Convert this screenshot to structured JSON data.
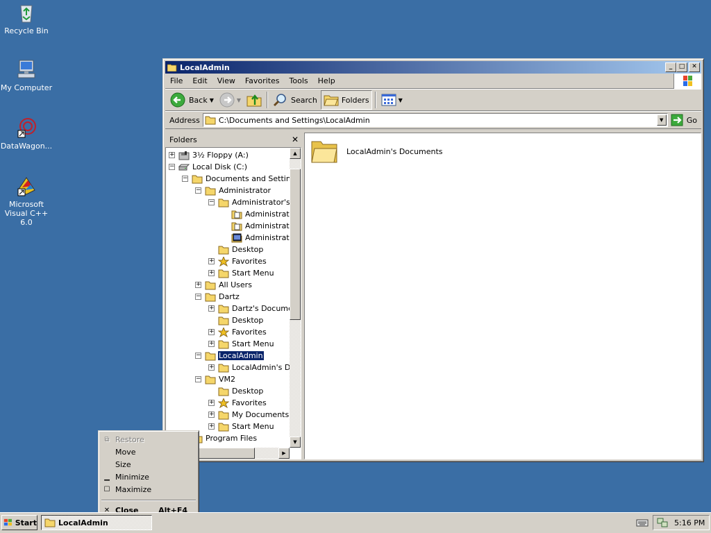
{
  "desktop": {
    "icons": [
      {
        "label": "Recycle Bin"
      },
      {
        "label": "My Computer"
      },
      {
        "label": "DataWagon..."
      },
      {
        "label": "Microsoft Visual C++ 6.0"
      }
    ]
  },
  "window": {
    "title": "LocalAdmin",
    "menu": [
      "File",
      "Edit",
      "View",
      "Favorites",
      "Tools",
      "Help"
    ],
    "toolbar": {
      "back_label": "Back",
      "search_label": "Search",
      "folders_label": "Folders"
    },
    "address": {
      "label": "Address",
      "value": "C:\\Documents and Settings\\LocalAdmin",
      "go_label": "Go"
    },
    "folders_pane": {
      "title": "Folders",
      "tree": [
        {
          "label": "3½ Floppy (A:)",
          "expander": "+",
          "icon": "floppy-drive-icon"
        },
        {
          "label": "Local Disk (C:)",
          "expander": "−",
          "icon": "hard-disk-icon"
        },
        {
          "label": "Documents and Settings",
          "expander": "−",
          "icon": "folder-icon"
        },
        {
          "label": "Administrator",
          "expander": "−",
          "icon": "folder-icon"
        },
        {
          "label": "Administrator's Documents",
          "expander": "−",
          "icon": "folder-icon"
        },
        {
          "label": "Administrator",
          "expander": "",
          "icon": "document-folder-icon"
        },
        {
          "label": "Administrator",
          "expander": "",
          "icon": "document-folder-icon"
        },
        {
          "label": "Administrator",
          "expander": "",
          "icon": "video-folder-icon"
        },
        {
          "label": "Desktop",
          "expander": "",
          "icon": "folder-icon"
        },
        {
          "label": "Favorites",
          "expander": "+",
          "icon": "favorites-star-icon"
        },
        {
          "label": "Start Menu",
          "expander": "+",
          "icon": "folder-icon"
        },
        {
          "label": "All Users",
          "expander": "+",
          "icon": "folder-icon"
        },
        {
          "label": "Dartz",
          "expander": "−",
          "icon": "folder-icon"
        },
        {
          "label": "Dartz's Documents",
          "expander": "+",
          "icon": "folder-icon"
        },
        {
          "label": "Desktop",
          "expander": "",
          "icon": "folder-icon"
        },
        {
          "label": "Favorites",
          "expander": "+",
          "icon": "favorites-star-icon"
        },
        {
          "label": "Start Menu",
          "expander": "+",
          "icon": "folder-icon"
        },
        {
          "label": "LocalAdmin",
          "expander": "−",
          "icon": "folder-icon",
          "selected": true
        },
        {
          "label": "LocalAdmin's Documents",
          "expander": "+",
          "icon": "folder-icon"
        },
        {
          "label": "VM2",
          "expander": "−",
          "icon": "folder-icon"
        },
        {
          "label": "Desktop",
          "expander": "",
          "icon": "folder-icon"
        },
        {
          "label": "Favorites",
          "expander": "+",
          "icon": "favorites-star-icon"
        },
        {
          "label": "My Documents",
          "expander": "+",
          "icon": "folder-icon"
        },
        {
          "label": "Start Menu",
          "expander": "+",
          "icon": "folder-icon"
        },
        {
          "label": "Program Files",
          "expander": "+",
          "icon": "folder-icon"
        }
      ]
    },
    "files": [
      {
        "label": "LocalAdmin's Documents"
      }
    ]
  },
  "system_menu": {
    "items": [
      {
        "label": "Restore",
        "icon": "restore-icon",
        "disabled": true
      },
      {
        "label": "Move"
      },
      {
        "label": "Size"
      },
      {
        "label": "Minimize",
        "icon": "minimize-icon"
      },
      {
        "label": "Maximize",
        "icon": "maximize-icon"
      }
    ],
    "close": {
      "label": "Close",
      "shortcut": "Alt+F4"
    }
  },
  "taskbar": {
    "start_label": "Start",
    "task_label": "LocalAdmin",
    "clock": "5:16 PM"
  },
  "colors": {
    "desktop": "#3a6ea5",
    "title_active": "#0a246a",
    "face": "#d4d0c8",
    "selection": "#0a246a"
  }
}
